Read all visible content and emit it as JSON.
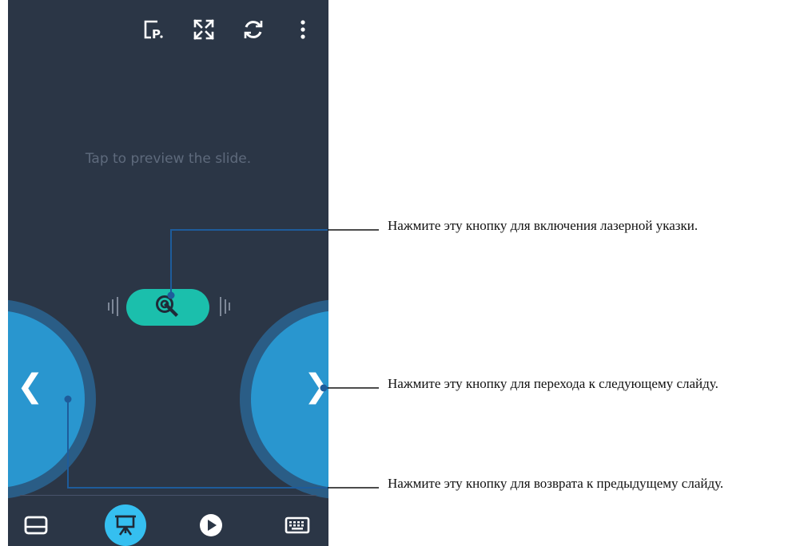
{
  "toolbar": {
    "icons": [
      "presentation-notes-icon",
      "fullscreen-icon",
      "refresh-icon",
      "more-vert-icon"
    ]
  },
  "main": {
    "hint": "Tap to preview the slide.",
    "laser_icon": "laser-pointer-icon",
    "prev_arrow": "❮",
    "next_arrow": "❯"
  },
  "bottom_nav": {
    "items": [
      {
        "icon": "touchpad-icon",
        "active": false
      },
      {
        "icon": "presentation-icon",
        "active": true
      },
      {
        "icon": "play-icon",
        "active": false
      },
      {
        "icon": "keyboard-icon",
        "active": false
      }
    ]
  },
  "callouts": [
    {
      "text": "Нажмите эту кнопку для включения лазерной указки."
    },
    {
      "text": "Нажмите эту кнопку для перехода к следующему слайду."
    },
    {
      "text": "Нажмите эту кнопку для возврата к предыдущему слайду."
    }
  ],
  "colors": {
    "background": "#2b3646",
    "laser_button": "#1bbfac",
    "nav_button": "#2996cf",
    "nav_ring": "#2a5d86",
    "active_tab": "#35bff0",
    "callout_line": "#1e5c9b"
  }
}
